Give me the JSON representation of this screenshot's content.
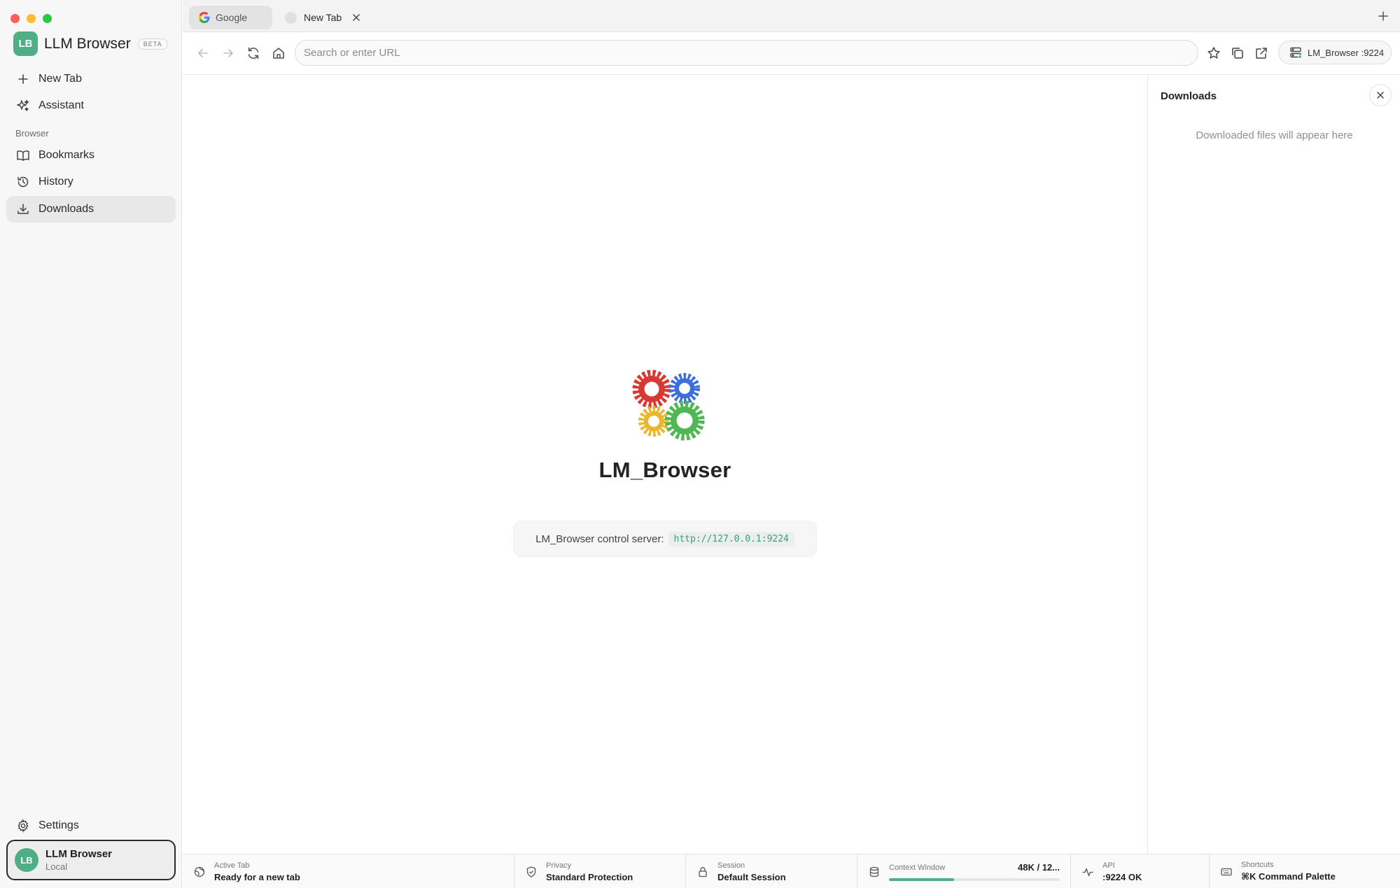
{
  "sidebar": {
    "brand": {
      "initials": "LB",
      "name": "LLM Browser",
      "badge": "BETA"
    },
    "primary": [
      {
        "label": "New Tab",
        "icon": "plus-icon"
      },
      {
        "label": "Assistant",
        "icon": "sparkles-icon"
      }
    ],
    "section_label": "Browser",
    "items": [
      {
        "label": "Bookmarks",
        "icon": "book-icon",
        "active": false
      },
      {
        "label": "History",
        "icon": "history-icon",
        "active": false
      },
      {
        "label": "Downloads",
        "icon": "download-icon",
        "active": true
      }
    ],
    "settings_label": "Settings",
    "user": {
      "initials": "LB",
      "name": "LLM Browser",
      "sub": "Local"
    }
  },
  "tabs": [
    {
      "label": "Google",
      "icon": "google-icon",
      "active": false
    },
    {
      "label": "New Tab",
      "icon": "blank-page-icon",
      "active": true
    }
  ],
  "toolbar": {
    "url_placeholder": "Search or enter URL",
    "url_value": "",
    "server_label": "LM_Browser :9224"
  },
  "main": {
    "title": "LM_Browser",
    "server_text": "LM_Browser control server:",
    "server_url": "http://127.0.0.1:9224"
  },
  "downloads_panel": {
    "title": "Downloads",
    "empty_text": "Downloaded files will appear here"
  },
  "status": {
    "active_tab": {
      "label": "Active Tab",
      "value": "Ready for a new tab"
    },
    "privacy": {
      "label": "Privacy",
      "value": "Standard Protection"
    },
    "session": {
      "label": "Session",
      "value": "Default Session"
    },
    "context": {
      "label": "Context Window",
      "value": "48K / 12...",
      "fill_fraction": 0.38
    },
    "api": {
      "label": "API",
      "value": ":9224 OK"
    },
    "shortcuts": {
      "label": "Shortcuts",
      "value": "⌘K Command Palette"
    }
  },
  "colors": {
    "accent": "#4fae86",
    "gear_red": "#d83a33",
    "gear_blue": "#3b6fe0",
    "gear_yellow": "#eab730",
    "gear_green": "#4fb854"
  }
}
